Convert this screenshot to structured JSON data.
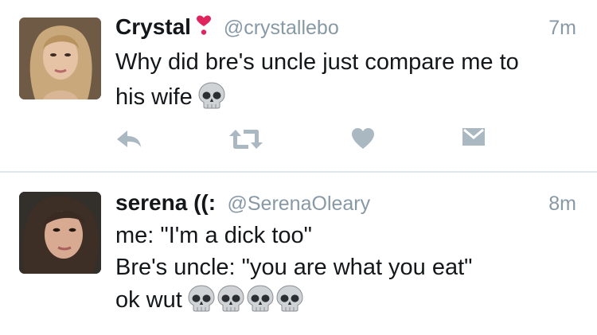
{
  "tweets": [
    {
      "name": "Crystal",
      "name_badge_icon": "heavy-heart-exclamation-icon",
      "handle": "@crystallebo",
      "time": "7m",
      "lines": [
        "Why did bre's uncle just compare me to",
        "his wife"
      ],
      "emoji": [
        "skull-emoji"
      ],
      "actions": [
        "reply-icon",
        "retweet-icon",
        "like-icon",
        "direct-message-icon"
      ]
    },
    {
      "name": "serena ((:",
      "handle": "@SerenaOleary",
      "time": "8m",
      "lines": [
        "me: \"I'm a dick too\"",
        "Bre's uncle: \"you are what you eat\"",
        "ok wut"
      ],
      "emoji": [
        "skull-emoji",
        "skull-emoji",
        "skull-emoji",
        "skull-emoji"
      ]
    }
  ],
  "colors": {
    "text": "#14171a",
    "secondary": "#8899a6",
    "action_icons": "#aab8c2",
    "divider": "#e1e8ed",
    "heart": "#e0245e"
  }
}
